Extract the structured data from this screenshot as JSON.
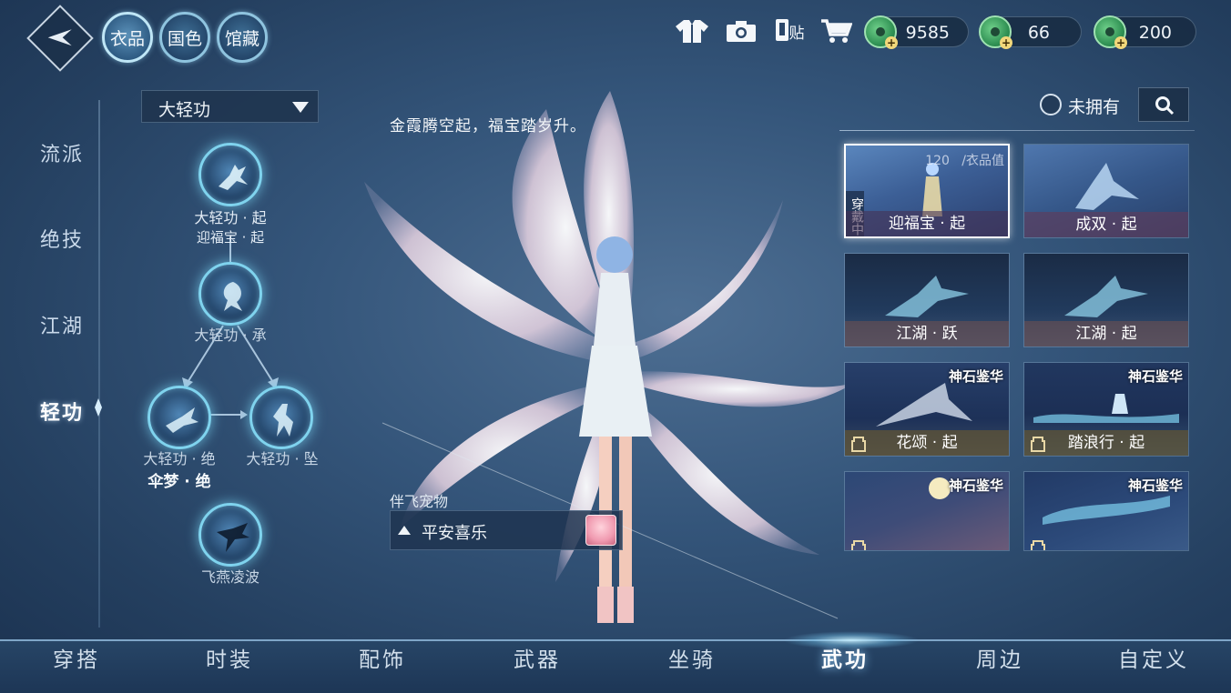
{
  "top_tabs": [
    {
      "label": "衣品",
      "active": true
    },
    {
      "label": "国色",
      "active": false
    },
    {
      "label": "馆藏",
      "active": false
    }
  ],
  "toolbar": {
    "icons": [
      "outfit-icon",
      "camera-icon",
      "sticker-icon",
      "cart-icon"
    ],
    "sticker_label": "贴"
  },
  "currencies": [
    {
      "icon": "jade-coin-icon",
      "value": "9585"
    },
    {
      "icon": "jade-coin-icon",
      "value": "66"
    },
    {
      "icon": "jade-coin-icon",
      "value": "200"
    }
  ],
  "sidebar": {
    "items": [
      {
        "label": "流派",
        "active": false
      },
      {
        "label": "绝技",
        "active": false
      },
      {
        "label": "江湖",
        "active": false
      },
      {
        "label": "轻功",
        "active": true
      }
    ]
  },
  "skill_tree": {
    "dropdown": "大轻功",
    "nodes": [
      {
        "line1": "大轻功 · 起",
        "line2": "迎福宝 · 起"
      },
      {
        "line1": "大轻功 · 承",
        "line2": ""
      },
      {
        "line1": "大轻功 · 绝",
        "line2": "伞梦 · 绝"
      },
      {
        "line1": "大轻功 · 坠",
        "line2": ""
      },
      {
        "line1": "飞燕凌波",
        "line2": ""
      }
    ]
  },
  "center": {
    "quote": "金霞腾空起，福宝踏岁升。",
    "pet_label": "伴飞宠物",
    "pet_name": "平安喜乐"
  },
  "filter": {
    "not_owned_label": "未拥有"
  },
  "cards": [
    {
      "name": "迎福宝 · 起",
      "tag": "",
      "value": "120",
      "value_suffix": "/衣品值",
      "wearing": "穿戴中",
      "selected": true,
      "locked": false
    },
    {
      "name": "成双 · 起",
      "tag": "",
      "selected": false,
      "locked": false
    },
    {
      "name": "江湖 · 跃",
      "tag": "",
      "selected": false,
      "locked": false
    },
    {
      "name": "江湖 · 起",
      "tag": "",
      "selected": false,
      "locked": false
    },
    {
      "name": "花颂 · 起",
      "tag": "神石鉴华",
      "selected": false,
      "locked": true
    },
    {
      "name": "踏浪行 · 起",
      "tag": "神石鉴华",
      "selected": false,
      "locked": true
    },
    {
      "name": "",
      "tag": "神石鉴华",
      "selected": false,
      "locked": true
    },
    {
      "name": "",
      "tag": "神石鉴华",
      "selected": false,
      "locked": true
    }
  ],
  "bottom_nav": [
    {
      "label": "穿搭",
      "active": false
    },
    {
      "label": "时装",
      "active": false
    },
    {
      "label": "配饰",
      "active": false
    },
    {
      "label": "武器",
      "active": false
    },
    {
      "label": "坐骑",
      "active": false
    },
    {
      "label": "武功",
      "active": true
    },
    {
      "label": "周边",
      "active": false
    },
    {
      "label": "自定义",
      "active": false
    }
  ]
}
